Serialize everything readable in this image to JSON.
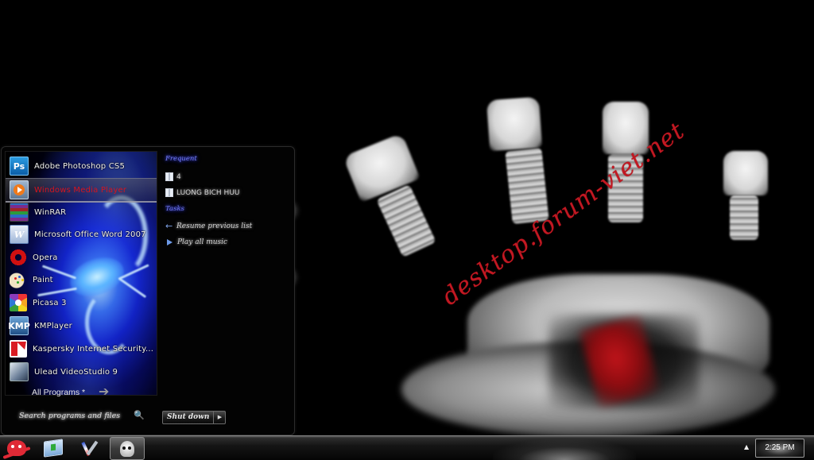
{
  "wallpaper": {
    "description": "Black and white handprint with red blood stain",
    "watermark": "desktop.forum-viet.net",
    "accent_color": "#c21822"
  },
  "start_menu": {
    "programs": [
      {
        "label": "Adobe Photoshop CS5",
        "icon": "photoshop-icon",
        "selected": false
      },
      {
        "label": "Windows Media Player",
        "icon": "windows-media-player-icon",
        "selected": true
      },
      {
        "label": "WinRAR",
        "icon": "winrar-icon",
        "selected": false
      },
      {
        "label": "Microsoft Office Word 2007",
        "icon": "word-icon",
        "selected": false
      },
      {
        "label": "Opera",
        "icon": "opera-icon",
        "selected": false
      },
      {
        "label": "Paint",
        "icon": "paint-icon",
        "selected": false
      },
      {
        "label": "Picasa 3",
        "icon": "picasa-icon",
        "selected": false
      },
      {
        "label": "KMPlayer",
        "icon": "kmplayer-icon",
        "selected": false
      },
      {
        "label": "Kaspersky Internet Security...",
        "icon": "kaspersky-icon",
        "selected": false
      },
      {
        "label": "Ulead VideoStudio 9",
        "icon": "ulead-icon",
        "selected": false
      }
    ],
    "all_programs_label": "All Programs *",
    "all_programs_arrow": "➔",
    "search_placeholder": "Search programs and files",
    "search_icon": "🔍",
    "jump_list": {
      "frequent_title": "Frequent",
      "frequent_items": [
        {
          "label": "4"
        },
        {
          "label": "LUONG BICH HUU"
        }
      ],
      "tasks_title": "Tasks",
      "task_items": [
        {
          "label": "Resume previous list",
          "icon": "←"
        },
        {
          "label": "Play all music",
          "icon": "play"
        }
      ]
    },
    "shutdown_label": "Shut down",
    "shutdown_arrow": "▶",
    "selected_color": "#d4141e"
  },
  "taskbar": {
    "start_button": "skull-crossbones-start-orb",
    "pinned": [
      {
        "name": "installer"
      },
      {
        "name": "tools"
      },
      {
        "name": "skull-app",
        "active": true
      }
    ],
    "tray_arrow": "▲",
    "clock": "2:25 PM"
  }
}
